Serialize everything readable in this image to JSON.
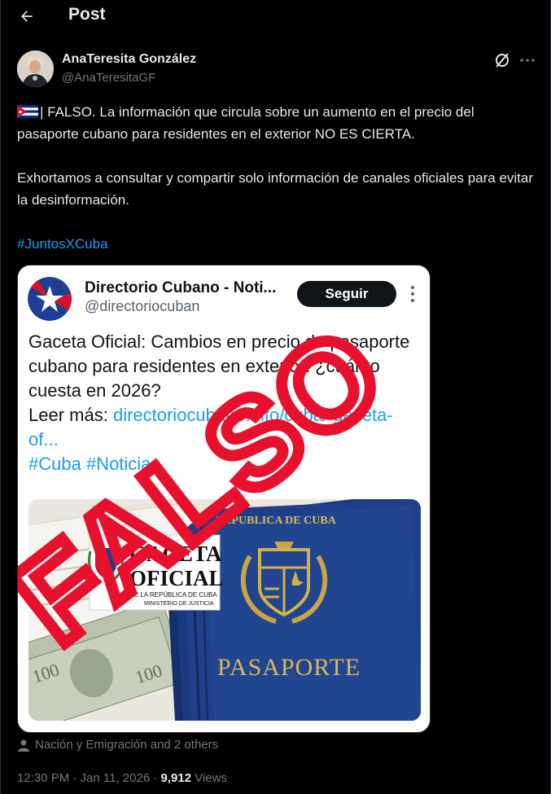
{
  "header": {
    "title": "Post"
  },
  "author": {
    "name": "AnaTeresita González",
    "handle": "@AnaTeresitaGF"
  },
  "tweet": {
    "paragraph1": "| FALSO. La información que circula sobre un aumento en el precio del pasaporte cubano para residentes en el exterior NO ES CIERTA.",
    "paragraph2": "Exhortamos a consultar y compartir solo información de canales oficiales para evitar la desinformación.",
    "hashtag": "#JuntosXCuba"
  },
  "embedded": {
    "name": "Directorio Cubano - Noti...",
    "handle": "@directoriocuban",
    "follow_label": "Seguir",
    "text_plain": "Gaceta Oficial: Cambios en precio de pasaporte cubano para residentes en exterior: ¿cuánto cuesta en 2026?",
    "read_more": "Leer más:",
    "link": "directoriocubano.info/cuba/ gaceta-of...",
    "hashtags": "#Cuba #Noticias",
    "stamp": "FALSO",
    "image": {
      "gaceta_line1": "GACETA",
      "gaceta_line2": "OFICIAL",
      "gaceta_sub1": "DE LA REPÚBLICA DE CUBA",
      "gaceta_sub2": "MINISTERIO DE JUSTICIA",
      "passport_top": "REPUBLICA DE CUBA",
      "passport_label": "PASAPORTE"
    }
  },
  "tagged": "Nación y Emigración and 2 others",
  "meta": {
    "time": "12:30 PM · Jan 11, 2026 · ",
    "views_count": "9,912",
    "views_label": " Views"
  },
  "colors": {
    "accent": "#1d9bf0",
    "stamp": "#e8112d",
    "passport": "#1f3f8a",
    "background": "#000000"
  }
}
